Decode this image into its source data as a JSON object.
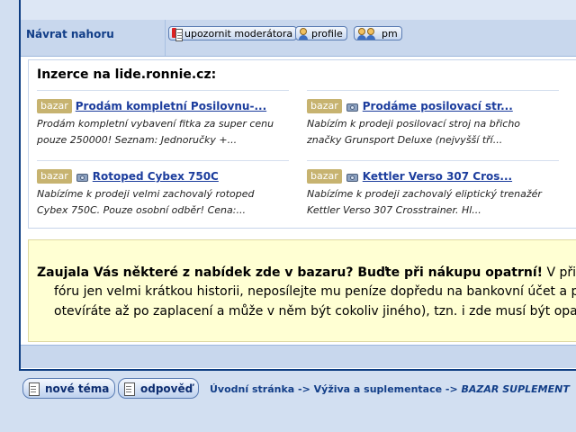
{
  "nav": {
    "back_to_top": "Návrat nahoru",
    "buttons": [
      {
        "label": "upozornit moderátora",
        "icon": "report-icon"
      },
      {
        "label": "profile",
        "icon": "profile-icon"
      },
      {
        "label": "pm",
        "icon": "pm-icon"
      }
    ]
  },
  "ads": {
    "title": "Inzerce na lide.ronnie.cz:",
    "items": [
      {
        "tag": "bazar",
        "link": "Prodám kompletní Posilovnu-...",
        "line1": "Prodám kompletní vybavení fitka za super cenu",
        "line2": "pouze 250000! Seznam: Jednoručky +...",
        "camera": false
      },
      {
        "tag": "bazar",
        "link": "Prodáme posilovací str...",
        "line1": "Nabízím k prodeji posilovací stroj na břicho",
        "line2": "značky Grunsport Deluxe (nejvyšší tří...",
        "camera": true
      },
      {
        "tag": "bazar",
        "link": "Rotoped Cybex 750C",
        "line1": "Nabízíme k prodeji velmi zachovalý rotoped",
        "line2": "Cybex 750C. Pouze osobní odběr! Cena:...",
        "camera": true
      },
      {
        "tag": "bazar",
        "link": "Kettler Verso 307 Cros...",
        "line1": "Nabízíme k prodeji zachovalý eliptický trenažér",
        "line2": "Kettler Verso 307 Crosstrainer. Hl...",
        "camera": true
      }
    ]
  },
  "warning": {
    "bold": "Zaujala Vás některé z nabídek zde v bazaru? Buďte při nákupu opatrní!",
    "rest1": " V přip",
    "line2": "fóru jen velmi krátkou historii, neposílejte mu peníze dopředu na bankovní účet a pre",
    "line3": "otevíráte až po zaplacení a může v něm být cokoliv jiného), tzn. i zde musí být opatrn"
  },
  "footer": {
    "new_topic": "nové téma",
    "reply": "odpověď",
    "crumbs": {
      "home": "Úvodní stránka",
      "sep": " -> ",
      "section": "Výživa a suplementace",
      "current": "BAZAR SUPLEMENT"
    }
  },
  "colors": {
    "tag": "#c7b370",
    "link": "#1c3d9d",
    "warning_bg": "#ffffd3",
    "page_bg": "#d2dff1"
  }
}
